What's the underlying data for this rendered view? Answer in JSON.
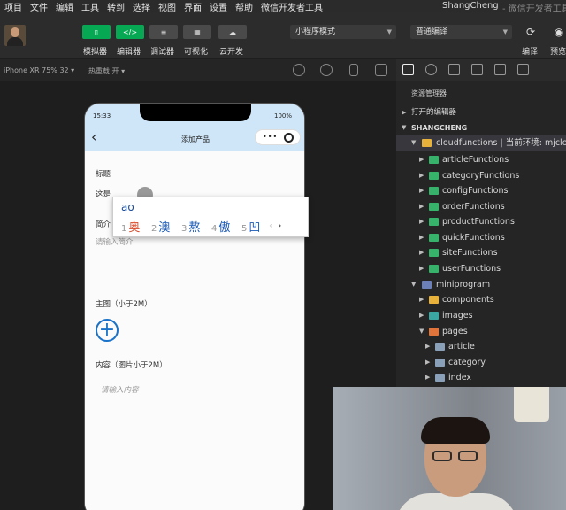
{
  "menu": {
    "items": [
      "项目",
      "文件",
      "编辑",
      "工具",
      "转到",
      "选择",
      "视图",
      "界面",
      "设置",
      "帮助",
      "微信开发者工具"
    ],
    "project_name": "ShangCheng",
    "app_name": "- 微信开发者工具"
  },
  "toolbar": {
    "simulator_label": "模拟器",
    "editor_label": "编辑器",
    "debugger_label": "调试器",
    "visual_label": "可视化",
    "cloud_label": "云开发",
    "mode_select": "小程序模式",
    "compile_select": "普通编译",
    "compile_label": "编译",
    "preview_label": "预览"
  },
  "simbar": {
    "device": "iPhone XR 75% 32 ▾",
    "hot_reload": "热重载 开 ▾"
  },
  "phone": {
    "time": "15:33",
    "battery": "100%",
    "page_title": "添加产品",
    "field_title_label": "标题",
    "field_title_value": "这是",
    "field_intro_label": "简介",
    "field_intro_placeholder": "请输入简介",
    "main_image_label": "主图（小于2M）",
    "content_label": "内容（图片小于2M）",
    "content_placeholder": "请输入内容"
  },
  "ime": {
    "composition": "ao",
    "candidates": [
      {
        "num": "1",
        "char": "奥"
      },
      {
        "num": "2",
        "char": "澳"
      },
      {
        "num": "3",
        "char": "熬"
      },
      {
        "num": "4",
        "char": "傲"
      },
      {
        "num": "5",
        "char": "凹"
      }
    ],
    "prev": "‹",
    "next": "›"
  },
  "explorer": {
    "header": "资源管理器",
    "open_editors": "打开的编辑器",
    "project_root": "SHANGCHENG",
    "cloudfunctions": "cloudfunctions | 当前环境: mjclo",
    "functions": [
      "articleFunctions",
      "categoryFunctions",
      "configFunctions",
      "orderFunctions",
      "productFunctions",
      "quickFunctions",
      "siteFunctions",
      "userFunctions"
    ],
    "miniprogram": "miniprogram",
    "components": "components",
    "images": "images",
    "pages": "pages",
    "page_dirs": [
      "article",
      "category",
      "index"
    ]
  },
  "colors": {
    "accent_green": "#07a854",
    "nav_bg": "#cfe6f8",
    "link_blue": "#1a73c9"
  }
}
